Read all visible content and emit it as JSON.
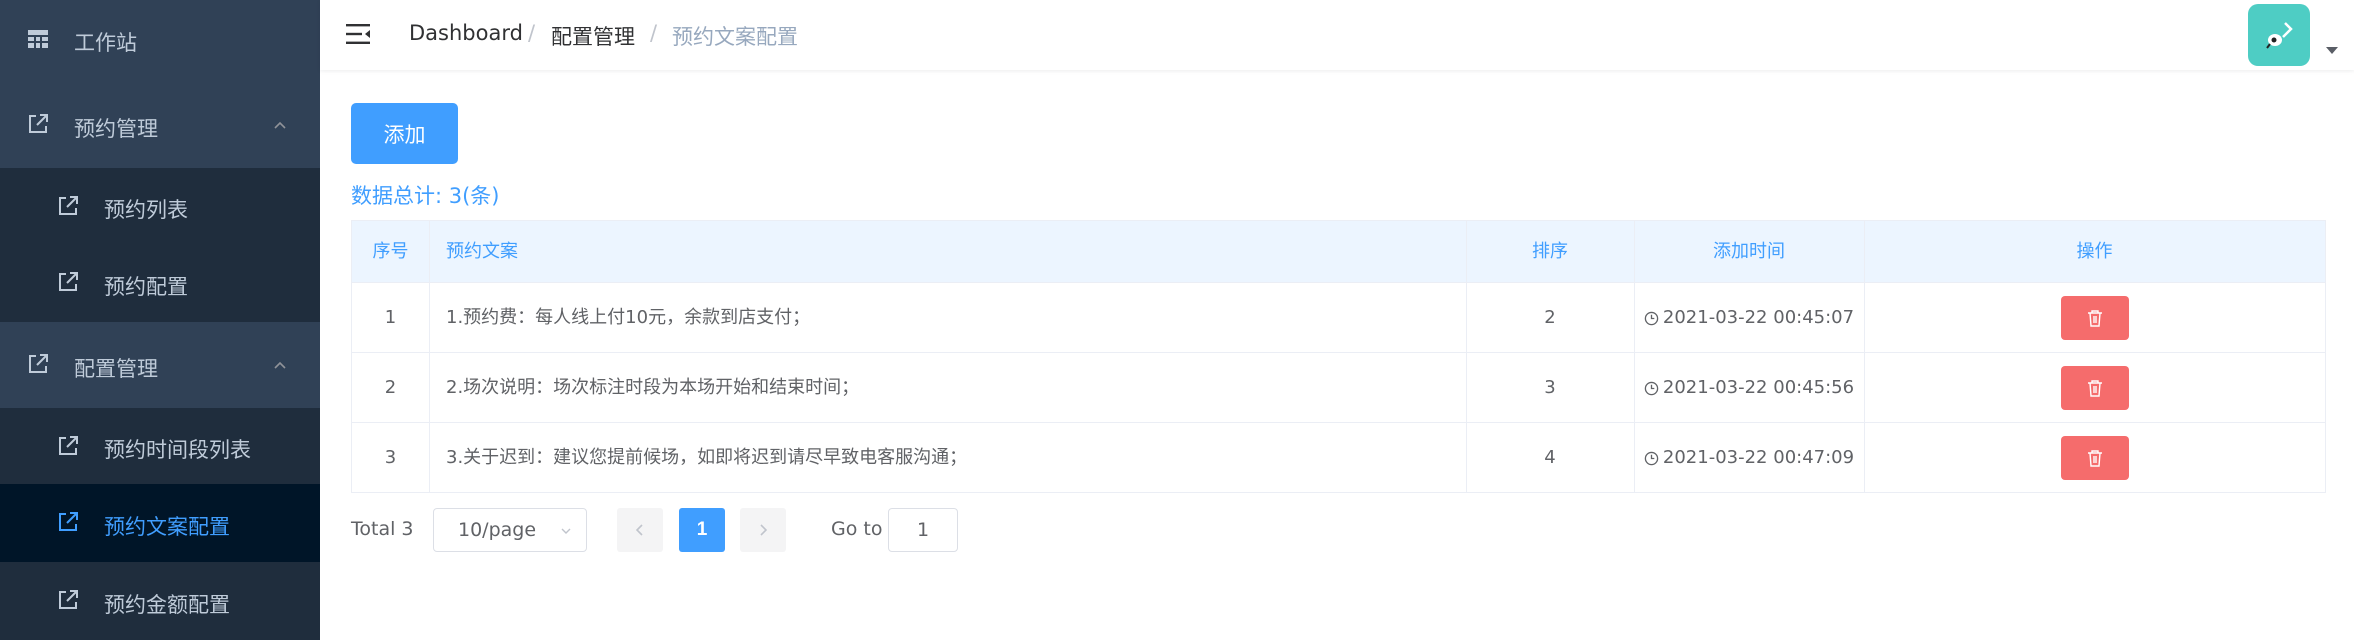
{
  "sidebar": {
    "items": [
      {
        "label": "工作站",
        "icon": "grid-icon"
      },
      {
        "label": "预约管理",
        "icon": "external-link-icon",
        "expanded": true
      },
      {
        "label": "预约列表",
        "icon": "external-link-icon"
      },
      {
        "label": "预约配置",
        "icon": "external-link-icon"
      },
      {
        "label": "配置管理",
        "icon": "external-link-icon",
        "expanded": true
      },
      {
        "label": "预约时间段列表",
        "icon": "external-link-icon"
      },
      {
        "label": "预约文案配置",
        "icon": "external-link-icon",
        "active": true
      },
      {
        "label": "预约金额配置",
        "icon": "external-link-icon"
      }
    ]
  },
  "header": {
    "breadcrumb": [
      "Dashboard",
      "配置管理",
      "预约文案配置"
    ],
    "separator": "/"
  },
  "main": {
    "add_label": "添加",
    "total_text": "数据总计: 3(条)",
    "table": {
      "headers": [
        "序号",
        "预约文案",
        "排序",
        "添加时间",
        "操作"
      ],
      "rows": [
        {
          "index": "1",
          "text": "1.预约费：每人线上付10元，余款到店支付；",
          "sort": "2",
          "time": "2021-03-22 00:45:07"
        },
        {
          "index": "2",
          "text": "2.场次说明：场次标注时段为本场开始和结束时间；",
          "sort": "3",
          "time": "2021-03-22 00:45:56"
        },
        {
          "index": "3",
          "text": "3.关于迟到：建议您提前候场，如即将迟到请尽早致电客服沟通；",
          "sort": "4",
          "time": "2021-03-22 00:47:09"
        }
      ]
    }
  },
  "pagination": {
    "total_label": "Total 3",
    "page_size": "10/page",
    "current_page": "1",
    "goto_label": "Go to",
    "goto_value": "1"
  },
  "colors": {
    "sidebar_bg": "#304156",
    "submenu_bg": "#1f2d3d",
    "active_bg": "#001528",
    "primary": "#409eff",
    "danger": "#f56c6c",
    "avatar_bg": "#4ecdc4"
  }
}
